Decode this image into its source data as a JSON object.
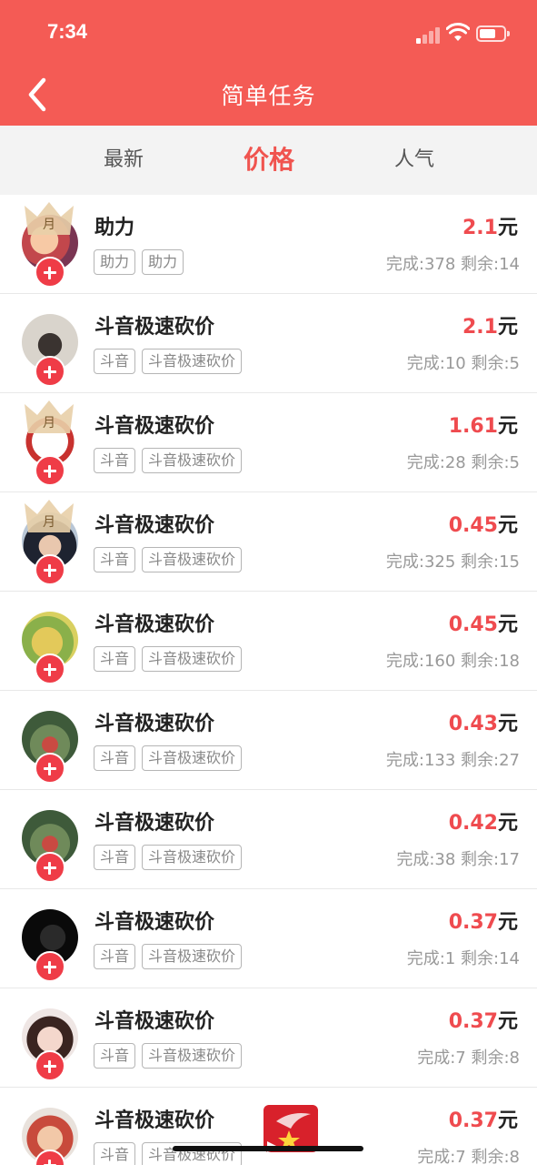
{
  "status_bar": {
    "time": "7:34"
  },
  "header": {
    "title": "简单任务"
  },
  "tabs": [
    {
      "label": "最新"
    },
    {
      "label": "价格"
    },
    {
      "label": "人气"
    }
  ],
  "colors": {
    "brand": "#f45b55",
    "price": "#ef4b4f",
    "plus": "#ef3c47"
  },
  "crown_label": "月",
  "tasks": [
    {
      "title": "助力",
      "tags": [
        "助力",
        "助力"
      ],
      "price": "2.1",
      "unit": "元",
      "done": "完成:378",
      "remain": "剩余:14"
    },
    {
      "title": "斗音极速砍价",
      "tags": [
        "斗音",
        "斗音极速砍价"
      ],
      "price": "2.1",
      "unit": "元",
      "done": "完成:10",
      "remain": "剩余:5"
    },
    {
      "title": "斗音极速砍价",
      "tags": [
        "斗音",
        "斗音极速砍价"
      ],
      "price": "1.61",
      "unit": "元",
      "done": "完成:28",
      "remain": "剩余:5"
    },
    {
      "title": "斗音极速砍价",
      "tags": [
        "斗音",
        "斗音极速砍价"
      ],
      "price": "0.45",
      "unit": "元",
      "done": "完成:325",
      "remain": "剩余:15"
    },
    {
      "title": "斗音极速砍价",
      "tags": [
        "斗音",
        "斗音极速砍价"
      ],
      "price": "0.45",
      "unit": "元",
      "done": "完成:160",
      "remain": "剩余:18"
    },
    {
      "title": "斗音极速砍价",
      "tags": [
        "斗音",
        "斗音极速砍价"
      ],
      "price": "0.43",
      "unit": "元",
      "done": "完成:133",
      "remain": "剩余:27"
    },
    {
      "title": "斗音极速砍价",
      "tags": [
        "斗音",
        "斗音极速砍价"
      ],
      "price": "0.42",
      "unit": "元",
      "done": "完成:38",
      "remain": "剩余:17"
    },
    {
      "title": "斗音极速砍价",
      "tags": [
        "斗音",
        "斗音极速砍价"
      ],
      "price": "0.37",
      "unit": "元",
      "done": "完成:1",
      "remain": "剩余:14"
    },
    {
      "title": "斗音极速砍价",
      "tags": [
        "斗音",
        "斗音极速砍价"
      ],
      "price": "0.37",
      "unit": "元",
      "done": "完成:7",
      "remain": "剩余:8"
    },
    {
      "title": "斗音极速砍价",
      "tags": [
        "斗音",
        "斗音极速砍价"
      ],
      "price": "0.37",
      "unit": "元",
      "done": "完成:7",
      "remain": "剩余:8"
    }
  ]
}
